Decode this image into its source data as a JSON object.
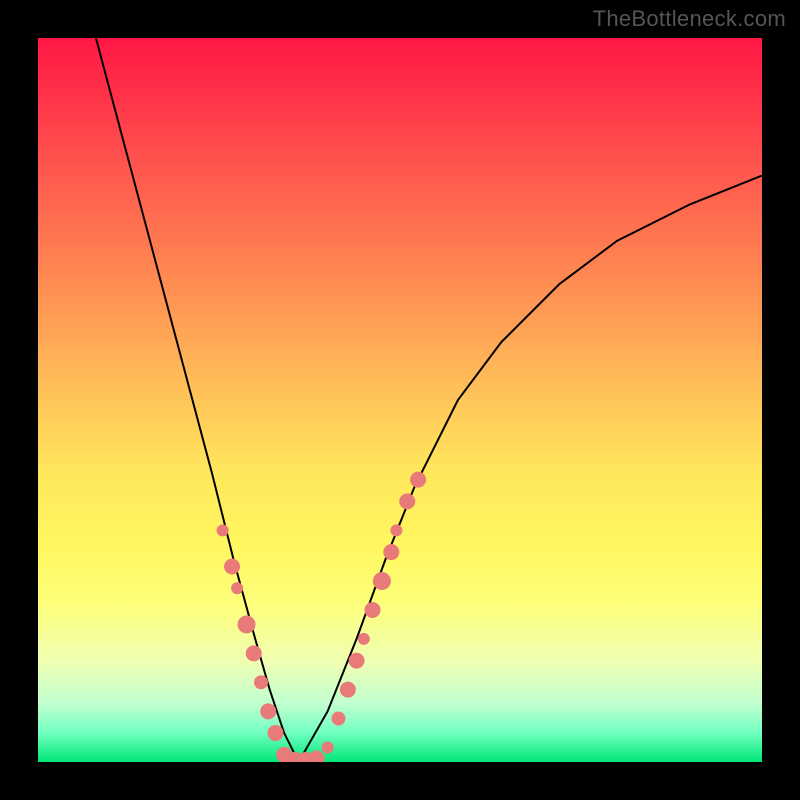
{
  "watermark": "TheBottleneck.com",
  "chart_data": {
    "type": "line",
    "title": "",
    "xlabel": "",
    "ylabel": "",
    "xlim": [
      0,
      100
    ],
    "ylim": [
      0,
      100
    ],
    "curve_left": {
      "x": [
        8,
        12,
        16,
        20,
        24,
        27,
        30,
        32,
        34,
        36
      ],
      "y": [
        100,
        85,
        70,
        55,
        40,
        28,
        17,
        10,
        4,
        0
      ]
    },
    "curve_right": {
      "x": [
        36,
        40,
        44,
        48,
        52,
        58,
        64,
        72,
        80,
        90,
        100
      ],
      "y": [
        0,
        7,
        17,
        28,
        38,
        50,
        58,
        66,
        72,
        77,
        81
      ]
    },
    "valley_floor": {
      "x": [
        33,
        40
      ],
      "y": [
        0,
        0
      ]
    },
    "dots_left_arm": [
      {
        "x": 25.5,
        "y": 32,
        "r": 6
      },
      {
        "x": 26.8,
        "y": 27,
        "r": 8
      },
      {
        "x": 27.5,
        "y": 24,
        "r": 6
      },
      {
        "x": 28.8,
        "y": 19,
        "r": 9
      },
      {
        "x": 29.8,
        "y": 15,
        "r": 8
      },
      {
        "x": 30.8,
        "y": 11,
        "r": 7
      },
      {
        "x": 31.8,
        "y": 7,
        "r": 8
      },
      {
        "x": 32.8,
        "y": 4,
        "r": 8
      }
    ],
    "dots_valley": [
      {
        "x": 34,
        "y": 1,
        "r": 8
      },
      {
        "x": 35.5,
        "y": 0.3,
        "r": 8
      },
      {
        "x": 37,
        "y": 0.3,
        "r": 8
      },
      {
        "x": 38.5,
        "y": 0.5,
        "r": 8
      },
      {
        "x": 40,
        "y": 2,
        "r": 6
      }
    ],
    "dots_right_arm": [
      {
        "x": 41.5,
        "y": 6,
        "r": 7
      },
      {
        "x": 42.8,
        "y": 10,
        "r": 8
      },
      {
        "x": 44,
        "y": 14,
        "r": 8
      },
      {
        "x": 45,
        "y": 17,
        "r": 6
      },
      {
        "x": 46.2,
        "y": 21,
        "r": 8
      },
      {
        "x": 47.5,
        "y": 25,
        "r": 9
      },
      {
        "x": 48.8,
        "y": 29,
        "r": 8
      },
      {
        "x": 49.5,
        "y": 32,
        "r": 6
      },
      {
        "x": 51,
        "y": 36,
        "r": 8
      },
      {
        "x": 52.5,
        "y": 39,
        "r": 8
      }
    ]
  }
}
